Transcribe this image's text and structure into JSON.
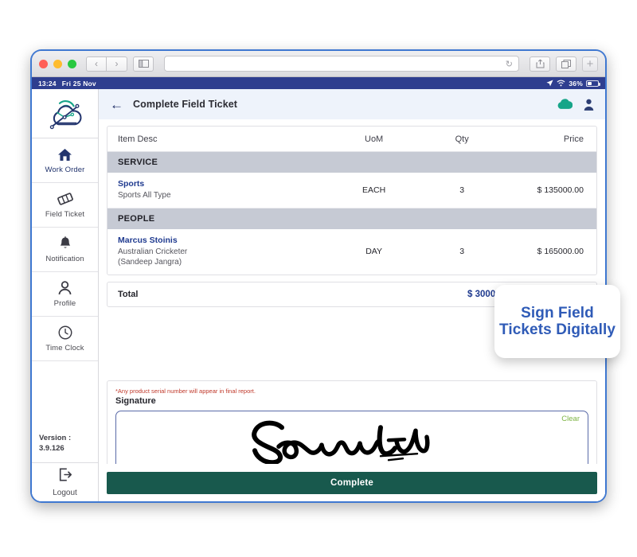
{
  "browser": {
    "back_icon": "chevron-left-icon",
    "forward_icon": "chevron-right-icon",
    "sidebar_toggle_icon": "sidebar-toggle-icon",
    "address_value": "",
    "address_placeholder": "",
    "reload_icon": "reload-icon",
    "share_icon": "share-icon",
    "tabs_icon": "tabs-icon",
    "new_tab_label": "+"
  },
  "status_bar": {
    "time": "13:24",
    "date": "Fri 25 Nov",
    "location_icon": "location-arrow-icon",
    "wifi_icon": "wifi-icon",
    "battery_percent": "36%"
  },
  "sidebar": {
    "logo_icon": "cloud-network-logo-icon",
    "items": [
      {
        "label": "Work Order",
        "icon": "home-icon",
        "active": true
      },
      {
        "label": "Field Ticket",
        "icon": "ticket-icon",
        "active": false
      },
      {
        "label": "Notification",
        "icon": "bell-icon",
        "active": false
      },
      {
        "label": "Profile",
        "icon": "person-icon",
        "active": false
      },
      {
        "label": "Time Clock",
        "icon": "clock-icon",
        "active": false
      }
    ],
    "version_label": "Version :",
    "version_number": "3.9.126",
    "logout_label": "Logout",
    "logout_icon": "logout-icon"
  },
  "header": {
    "back_icon": "arrow-left-icon",
    "title": "Complete Field Ticket",
    "cloud_icon": "cloud-icon",
    "user_icon": "user-avatar-icon"
  },
  "table": {
    "columns": [
      "Item Desc",
      "UoM",
      "Qty",
      "Price"
    ],
    "groups": [
      {
        "name": "SERVICE",
        "rows": [
          {
            "name": "Sports",
            "sub1": "Sports All Type",
            "sub2": "",
            "uom": "EACH",
            "qty": "3",
            "price": "$ 135000.00"
          }
        ]
      },
      {
        "name": "PEOPLE",
        "rows": [
          {
            "name": "Marcus Stoinis",
            "sub1": "Australian Cricketer",
            "sub2": "(Sandeep Jangra)",
            "uom": "DAY",
            "qty": "3",
            "price": "$ 165000.00"
          }
        ]
      }
    ],
    "total_label": "Total",
    "total_value": "$ 300000.00"
  },
  "signature": {
    "serial_note": "*Any product serial number will appear in final report.",
    "label": "Signature",
    "clear_label": "Clear",
    "signature_icon": "handwritten-signature-icon"
  },
  "actions": {
    "complete_label": "Complete"
  },
  "callout": {
    "text": "Sign Field Tickets Digitally"
  },
  "colors": {
    "frame_blue": "#3f78d1",
    "status_navy": "#2e3e8f",
    "header_bg": "#eef3fb",
    "group_row": "#c6cad4",
    "accent_navy": "#1f3a8f",
    "complete_green": "#18594d",
    "clear_green": "#7cb342",
    "note_red": "#c0392b",
    "callout_blue": "#2f5bb7",
    "cloud_teal": "#17a589"
  }
}
